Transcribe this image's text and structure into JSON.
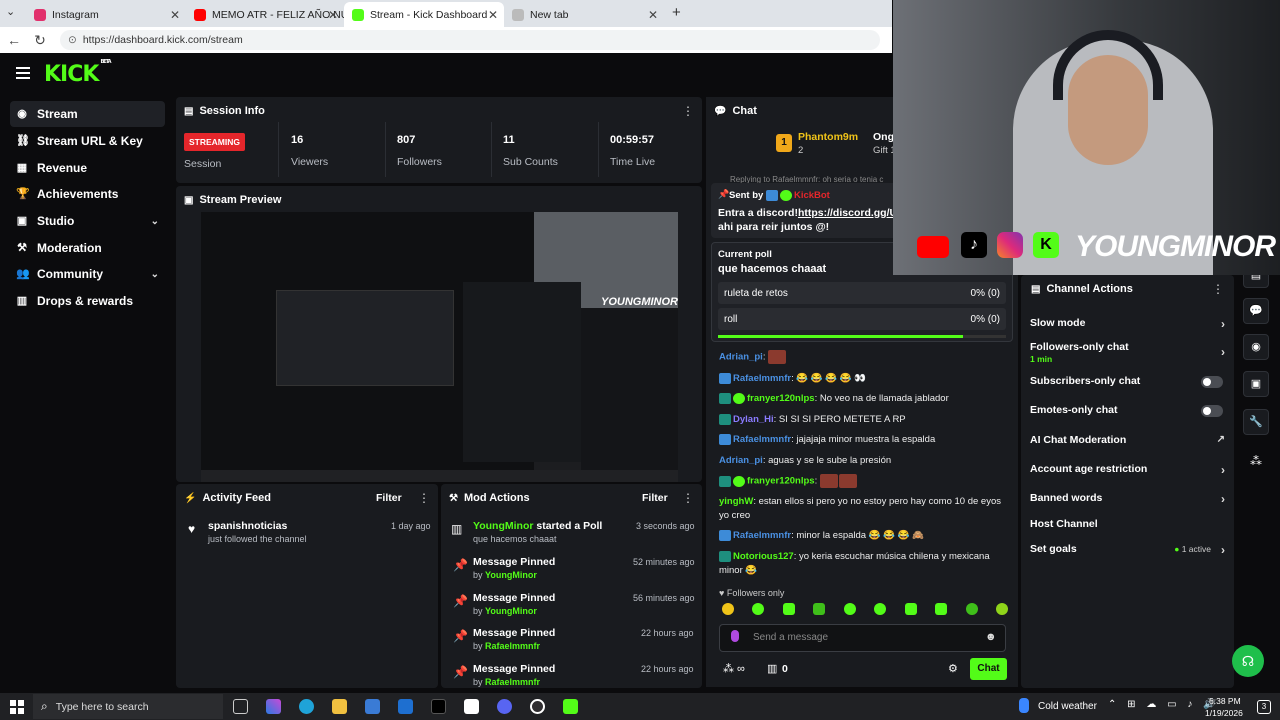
{
  "browser": {
    "tabs": [
      {
        "label": "Instagram",
        "color": "#e1306c"
      },
      {
        "label": "MEMO ATR - FELIZ AÑO NUEVO",
        "color": "#ff0000"
      },
      {
        "label": "Stream - Kick Dashboard",
        "color": "#53fc18"
      },
      {
        "label": "New tab",
        "color": "#888888"
      }
    ],
    "url": "https://dashboard.kick.com/stream"
  },
  "brand": {
    "logo": "KICK",
    "beta": "BETA"
  },
  "sidebar": {
    "items": [
      {
        "label": "Stream",
        "icon": "broadcast-icon",
        "glyph": "◉"
      },
      {
        "label": "Stream URL & Key",
        "icon": "link-icon",
        "glyph": "⛓"
      },
      {
        "label": "Revenue",
        "icon": "chart-icon",
        "glyph": "▦"
      },
      {
        "label": "Achievements",
        "icon": "trophy-icon",
        "glyph": "🏆"
      },
      {
        "label": "Studio",
        "icon": "studio-icon",
        "glyph": "▣"
      },
      {
        "label": "Moderation",
        "icon": "hammer-icon",
        "glyph": "⚒"
      },
      {
        "label": "Community",
        "icon": "people-icon",
        "glyph": "👥"
      },
      {
        "label": "Drops & rewards",
        "icon": "gift-icon",
        "glyph": "▥"
      }
    ]
  },
  "session": {
    "title": "Session Info",
    "badge": "STREAMING",
    "stats": [
      {
        "value": "",
        "label": "Session"
      },
      {
        "value": "16",
        "label": "Viewers"
      },
      {
        "value": "807",
        "label": "Followers"
      },
      {
        "value": "11",
        "label": "Sub Counts"
      },
      {
        "value": "00:59:57",
        "label": "Time Live"
      }
    ]
  },
  "preview": {
    "title": "Stream Preview",
    "overlay_name": "YOUNGMINOR"
  },
  "activity": {
    "title": "Activity Feed",
    "filter": "Filter",
    "items": [
      {
        "user": "spanishnoticias",
        "text": "just followed the channel",
        "time": "1 day ago"
      }
    ]
  },
  "mod": {
    "title": "Mod Actions",
    "filter": "Filter",
    "items": [
      {
        "title": "YoungMinor",
        "title_rest": " started a Poll",
        "sub": "que hacemos chaaat",
        "time": "3 seconds ago"
      },
      {
        "title": "Message Pinned",
        "by": "by ",
        "user": "YoungMinor",
        "time": "52 minutes ago"
      },
      {
        "title": "Message Pinned",
        "by": "by ",
        "user": "YoungMinor",
        "time": "56 minutes ago"
      },
      {
        "title": "Message Pinned",
        "by": "by ",
        "user": "Rafaelmmnfr",
        "time": "22 hours ago"
      },
      {
        "title": "Message Pinned",
        "by": "by ",
        "user": "Rafaelmmnfr",
        "time": "22 hours ago"
      }
    ]
  },
  "chat": {
    "title": "Chat",
    "top_user": "Phantom9m",
    "top_user_sub": "2",
    "top_right": "Ong",
    "top_right_sub": "Gift 1",
    "replying": "Replying to Rafaelmmnfr: oh seria o tenia c",
    "pinned": {
      "sent_by": "Sent by",
      "bot": "KickBot",
      "text_pre": "Entra a discord!",
      "link": "https://discord.gg/UXr",
      "text_post": "ahi para reir juntos @!"
    },
    "poll": {
      "label": "Current poll",
      "question": "que hacemos chaaat",
      "options": [
        {
          "label": "ruleta de retos",
          "pct": "0% (0)"
        },
        {
          "label": "roll",
          "pct": "0% (0)"
        }
      ]
    },
    "messages": [
      {
        "user": "Adrian_pi",
        "color": "#4a90e2",
        "text": ":",
        "emote": true
      },
      {
        "user": "Rafaelmmnfr",
        "color": "#4a90e2",
        "text": ": 😂 😂 😂 😂 👀"
      },
      {
        "user": "franyer120nlps",
        "color": "#53fc18",
        "text": ": No veo na de llamada jablador"
      },
      {
        "user": "Dylan_Hi",
        "color": "#8a7bff",
        "text": ": SI SI SI PERO METETE A RP"
      },
      {
        "user": "Rafaelmmnfr",
        "color": "#4a90e2",
        "text": ": jajajaja minor muestra la espalda"
      },
      {
        "user": "Adrian_pi",
        "color": "#4a90e2",
        "text": ": aguas y se le sube la presión"
      },
      {
        "user": "franyer120nlps",
        "color": "#53fc18",
        "text": ":",
        "emote": true
      },
      {
        "user": "yinghW",
        "color": "#53fc18",
        "text": ": estan ellos si pero yo no estoy pero hay como 10 de eyos yo creo"
      },
      {
        "user": "Rafaelmmnfr",
        "color": "#4a90e2",
        "text": ": minor la espalda 😂 😂 😂 🙈"
      },
      {
        "user": "Notorious127",
        "color": "#53fc18",
        "text": ": yo keria escuchar música chilena y mexicana minor 😂"
      }
    ],
    "followers_only": "Followers only",
    "input_placeholder": "Send a message",
    "count": "0",
    "chat_button": "Chat"
  },
  "channel_actions": {
    "title": "Channel Actions",
    "rows": [
      {
        "label": "Slow mode",
        "sub": "",
        "control": "arrow"
      },
      {
        "label": "Followers-only chat",
        "sub": "1 min",
        "control": "arrow"
      },
      {
        "label": "Subscribers-only chat",
        "sub": "",
        "control": "toggle"
      },
      {
        "label": "Emotes-only chat",
        "sub": "",
        "control": "toggle"
      },
      {
        "label": "AI Chat Moderation",
        "sub": "",
        "control": "external"
      },
      {
        "label": "Account age restriction",
        "sub": "",
        "control": "arrow"
      },
      {
        "label": "Banned words",
        "sub": "",
        "control": "arrow"
      },
      {
        "label": "Host Channel",
        "sub": "",
        "control": "none"
      },
      {
        "label": "Set goals",
        "sub": "",
        "control": "arrow",
        "status": "1 active"
      }
    ]
  },
  "webcam": {
    "name": "YOUNGMINOR"
  },
  "taskbar": {
    "search": "Type here to search",
    "weather": "Cold weather",
    "time": "6:38 PM",
    "date": "1/19/2026",
    "notif": "3"
  }
}
